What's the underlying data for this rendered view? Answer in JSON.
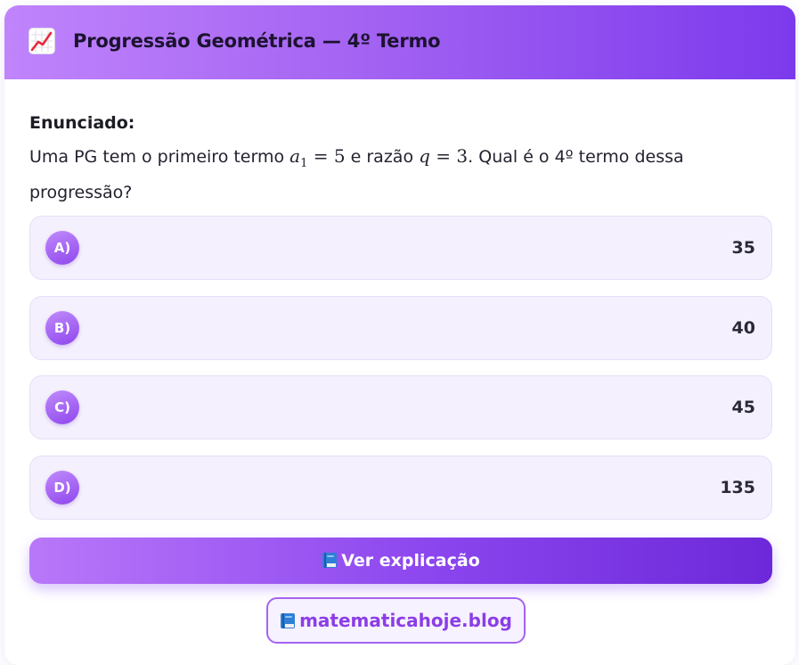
{
  "header": {
    "icon": "chart-increasing-icon",
    "title": "Progressão Geométrica — 4º Termo"
  },
  "statement": {
    "label": "Enunciado:",
    "text_before": "Uma PG tem o primeiro termo",
    "a1_symbol": "a",
    "a1_subscript": "1",
    "equals": "=",
    "a1_value": "5",
    "text_middle": "e razão",
    "q_symbol": "q",
    "q_value": "3",
    "text_after": ". Qual é o 4º termo dessa progressão?"
  },
  "options": [
    {
      "letter": "A)",
      "value": "35"
    },
    {
      "letter": "B)",
      "value": "40"
    },
    {
      "letter": "C)",
      "value": "45"
    },
    {
      "letter": "D)",
      "value": "135"
    }
  ],
  "actions": {
    "explain_label": "Ver explicação",
    "explain_icon": "blue-book-icon",
    "blog_label": "matematicahoje.blog",
    "blog_icon": "blue-book-icon"
  },
  "colors": {
    "accent": "#8b45ee",
    "header_gradient_start": "#c084fc",
    "header_gradient_end": "#7c3aed",
    "option_background": "#f4f0fd"
  }
}
